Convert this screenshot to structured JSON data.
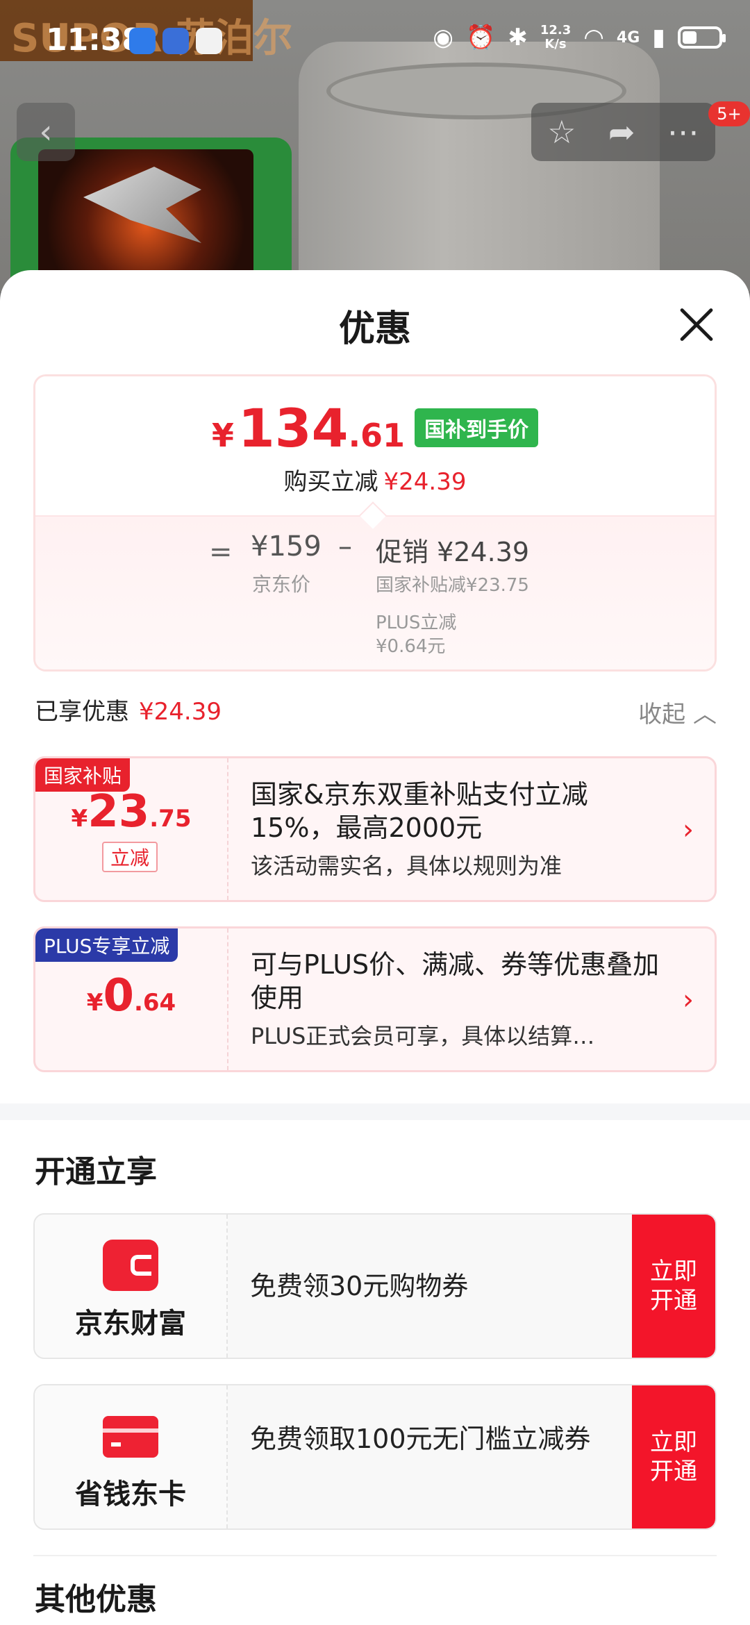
{
  "status_bar": {
    "time": "11:38",
    "net_speed_top": "12.3",
    "net_speed_bottom": "K/s",
    "network": "4G"
  },
  "background": {
    "brand_text": "SUPOR 苏泊尔"
  },
  "nav": {
    "back_glyph": "‹",
    "badge": "5+"
  },
  "sheet": {
    "title": "优惠",
    "price": {
      "symbol": "¥",
      "integer": "134",
      "decimal": ".61",
      "tag": "国补到手价",
      "buy_label": "购买立减",
      "buy_amount": "¥24.39",
      "equals": "=",
      "jd_price": "¥159",
      "jd_label": "京东价",
      "minus": "–",
      "promo_line": "促销 ¥24.39",
      "sub_national": "国家补贴减¥23.75",
      "sub_plus": "PLUS立减",
      "sub_plus_amount": "¥0.64元"
    },
    "enjoyed": {
      "label": "已享优惠",
      "amount": "¥24.39",
      "collapse": "收起 ︿"
    },
    "coupons": [
      {
        "tag": "国家补贴",
        "tag_color": "#e8222d",
        "symbol": "¥",
        "integer": "23",
        "decimal": ".75",
        "label": "立减",
        "title": "国家&京东双重补贴支付立减15%，最高2000元",
        "desc": "该活动需实名，具体以规则为准"
      },
      {
        "tag": "PLUS专享立减",
        "tag_color": "#2b3aa8",
        "symbol": "¥",
        "integer": "0",
        "decimal": ".64",
        "title": "可与PLUS价、满减、券等优惠叠加使用",
        "desc": "PLUS正式会员可享，具体以结算…"
      }
    ],
    "open_section": {
      "title": "开通立享",
      "items": [
        {
          "name": "京东财富",
          "text": "免费领30元购物券",
          "button": "立即开通"
        },
        {
          "name": "省钱东卡",
          "text": "免费领取100元无门槛立减券",
          "button": "立即开通"
        }
      ]
    },
    "other_section": {
      "title": "其他优惠"
    }
  },
  "colors": {
    "accent_red": "#e8222d",
    "green_tag": "#2fb54d",
    "plus_blue": "#2b3aa8",
    "button_red": "#f3152a"
  }
}
